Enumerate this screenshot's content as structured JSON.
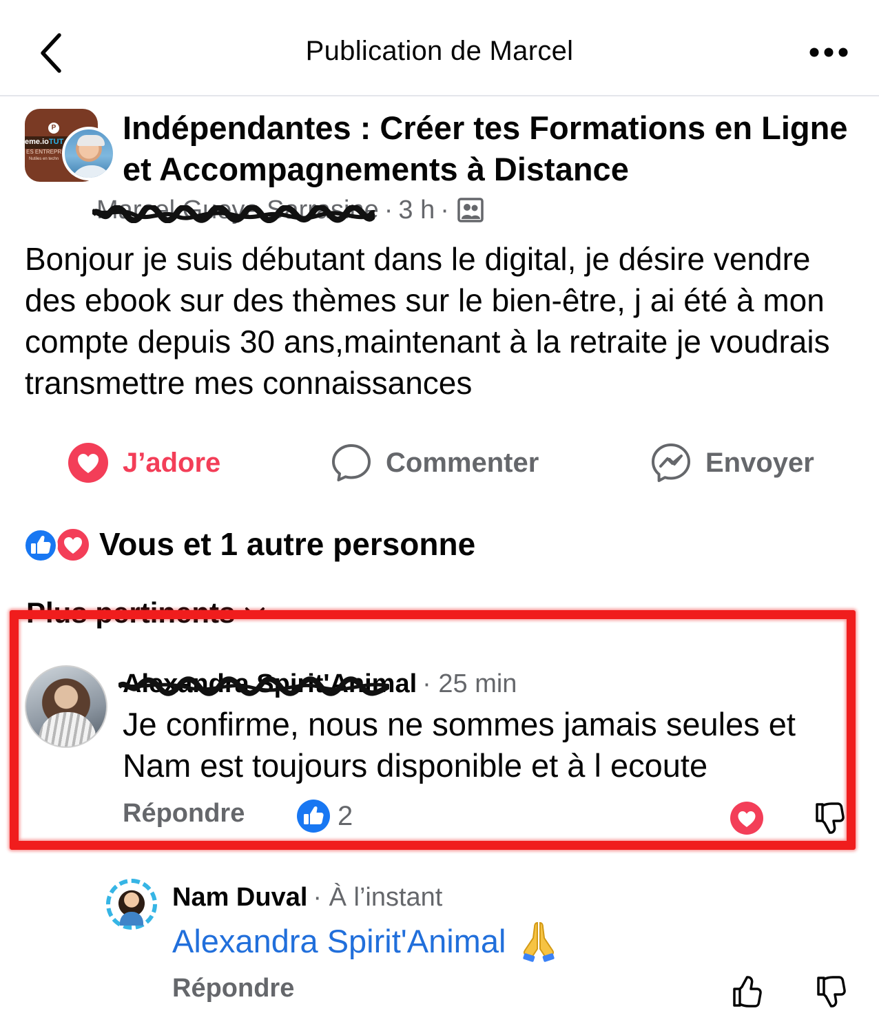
{
  "header": {
    "title": "Publication de Marcel",
    "back_icon": "chevron-left-icon",
    "more_icon": "more-horizontal-icon"
  },
  "post": {
    "group_name": "Indépendantes : Créer tes Formations en Ligne et Accompagnements à Distance",
    "group_avatar_text": {
      "brand_start": "eme.io",
      "brand_end": "TUT",
      "line1": "ES ENTREPR",
      "line2": "Nutiles en techn"
    },
    "author_name": "Marcel Gueye Sarrasine",
    "time": "3 h",
    "privacy_icon": "group-members-icon",
    "text": "Bonjour je suis débutant dans le digital, je désire vendre des ebook sur des thèmes sur le bien-être, j ai été à mon compte depuis 30 ans,maintenant à la retraite je voudrais transmettre mes connaissances"
  },
  "actions": {
    "love_label": "J’adore",
    "comment_label": "Commenter",
    "send_label": "Envoyer"
  },
  "reactions": {
    "summary": "Vous et 1 autre personne"
  },
  "sort": {
    "label": "Plus pertinents"
  },
  "comments": [
    {
      "author": "Alexandra Spirit'Animal",
      "time": "· 25 min",
      "text": "Je confirme, nous ne sommes jamais seules et Nam est toujours disponible et à l ecoute",
      "reply_label": "Répondre",
      "like_count": "2"
    },
    {
      "author": "Nam Duval",
      "time": "· À l’instant",
      "mention": "Alexandra Spirit'Animal",
      "emoji": "🙏",
      "reply_label": "Répondre"
    }
  ],
  "colors": {
    "love": "#f33e58",
    "like_blue": "#1877f2",
    "mention_blue": "#216fdb",
    "secondary_text": "#65676b",
    "highlight_red": "#f01d1d"
  }
}
